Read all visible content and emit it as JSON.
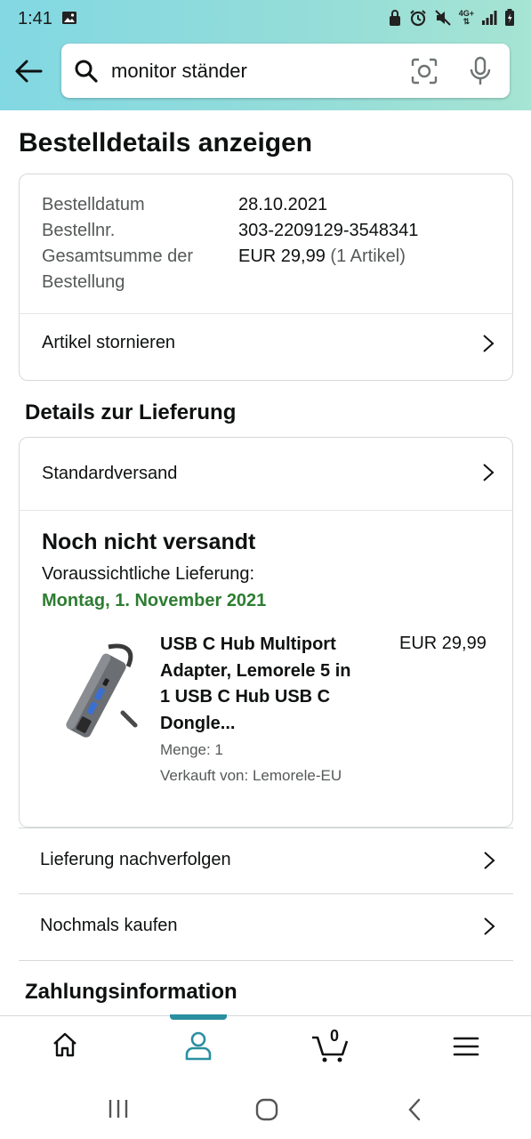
{
  "status_bar": {
    "time": "1:41",
    "network": "4G+"
  },
  "search": {
    "query": "monitor ständer"
  },
  "page": {
    "title": "Bestelldetails anzeigen"
  },
  "order": {
    "date_label": "Bestelldatum",
    "date_value": "28.10.2021",
    "number_label": "Bestellnr.",
    "number_value": "303-2209129-3548341",
    "total_label_line1": "Gesamtsumme der",
    "total_label_line2": "Bestellung",
    "total_value": "EUR 29,99",
    "total_items": "(1 Artikel)",
    "cancel_label": "Artikel stornieren"
  },
  "delivery": {
    "section_title": "Details zur Lieferung",
    "shipping_method": "Standardversand",
    "status": "Noch nicht versandt",
    "eta_label": "Voraussichtliche Lieferung:",
    "eta_date": "Montag, 1. November 2021",
    "product": {
      "title_lines": [
        "USB C Hub Multiport",
        "Adapter, Lemorele 5 in",
        "1 USB C Hub USB C",
        "Dongle..."
      ],
      "price": "EUR 29,99",
      "quantity": "Menge: 1",
      "seller": "Verkauft von: Lemorele-EU"
    }
  },
  "actions": {
    "track": "Lieferung nachverfolgen",
    "buy_again": "Nochmals kaufen"
  },
  "payment": {
    "section_title": "Zahlungsinformation"
  },
  "bottom_nav": {
    "items": [
      "home-icon",
      "account-icon",
      "cart-icon",
      "menu-icon"
    ],
    "active": "account-icon",
    "cart_count": "0",
    "accent_color": "#2a8fa0"
  },
  "colors": {
    "delivery_date": "#2e7d32",
    "header_start": "#82d8e3",
    "header_end": "#a6e4d3"
  }
}
